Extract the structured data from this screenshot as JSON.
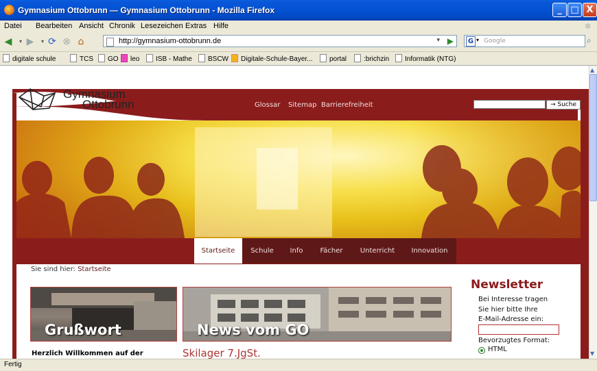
{
  "window": {
    "title": "Gymnasium Ottobrunn — Gymnasium Ottobrunn - Mozilla Firefox",
    "min": "_",
    "max": "□",
    "close": "X"
  },
  "menu": [
    "Datei",
    "Bearbeiten",
    "Ansicht",
    "Chronik",
    "Lesezeichen",
    "Extras",
    "Hilfe"
  ],
  "address": {
    "url": "http://gymnasium-ottobrunn.de"
  },
  "search": {
    "placeholder": "Google"
  },
  "bookmarks": [
    "digitale schule",
    "TCS",
    "GO",
    "leo",
    "ISB - Mathe",
    "BSCW",
    "Digitale-Schule-Bayer...",
    "portal",
    ":brichzin",
    "Informatik (NTG)"
  ],
  "site": {
    "logo_line1": "Gymnasium",
    "logo_line2": "Ottobrunn",
    "toplinks": [
      "Glossar",
      "Sitemap",
      "Barrierefreiheit"
    ],
    "search_button": "→ Suche",
    "tabs": [
      "Startseite",
      "Schule",
      "Info",
      "Fächer",
      "Unterricht",
      "Innovation"
    ],
    "breadcrumb_prefix": "Sie sind hier: ",
    "breadcrumb_current": "Startseite",
    "box1_label": "Grußwort",
    "box2_label": "News vom GO",
    "welcome": "Herzlich Willkommen auf der",
    "news_headline": "Skilager 7.JgSt.",
    "newsletter": {
      "title": "Newsletter",
      "lines": [
        "Bei Interesse tragen",
        "Sie hier bitte Ihre",
        "E-Mail-Adresse ein:"
      ],
      "format_label": "Bevorzugtes Format:",
      "format_option": "HTML"
    }
  },
  "status": {
    "text": "Fertig"
  },
  "colors": {
    "accent": "#8b1c1c",
    "nav_dark": "#5f1818",
    "xp_blue": "#0453d6"
  }
}
